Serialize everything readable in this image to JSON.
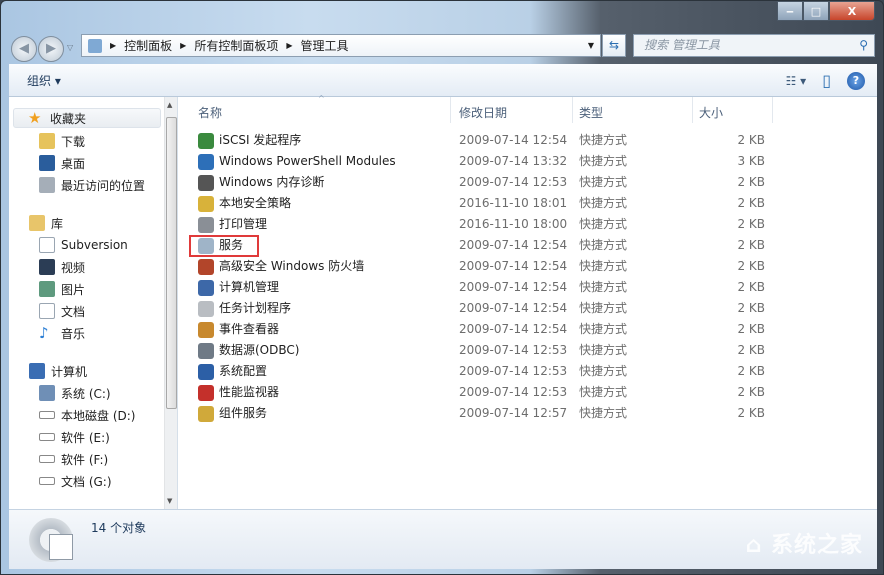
{
  "window": {
    "minimize": "‒",
    "maximize": "□",
    "close": "X"
  },
  "address": {
    "segments": [
      "控制面板",
      "所有控制面板项",
      "管理工具"
    ]
  },
  "search": {
    "placeholder": "搜索 管理工具"
  },
  "toolbar": {
    "organize": "组织 ▾",
    "views": "☷ ▾",
    "preview": "▯",
    "help": "?"
  },
  "nav": {
    "favorites": {
      "label": "收藏夹",
      "items": [
        "下载",
        "桌面",
        "最近访问的位置"
      ]
    },
    "libraries": {
      "label": "库",
      "items": [
        "Subversion",
        "视频",
        "图片",
        "文档",
        "音乐"
      ]
    },
    "computer": {
      "label": "计算机",
      "items": [
        "系统 (C:)",
        "本地磁盘 (D:)",
        "软件 (E:)",
        "软件 (F:)",
        "文档 (G:)"
      ]
    }
  },
  "columns": {
    "name": "名称",
    "date": "修改日期",
    "type": "类型",
    "size": "大小"
  },
  "files": [
    {
      "name": "iSCSI 发起程序",
      "date": "2009-07-14 12:54",
      "type": "快捷方式",
      "size": "2 KB",
      "color": "#3a8a3e"
    },
    {
      "name": "Windows PowerShell Modules",
      "date": "2009-07-14 13:32",
      "type": "快捷方式",
      "size": "3 KB",
      "color": "#2d6fb8"
    },
    {
      "name": "Windows 内存诊断",
      "date": "2009-07-14 12:53",
      "type": "快捷方式",
      "size": "2 KB",
      "color": "#555"
    },
    {
      "name": "本地安全策略",
      "date": "2016-11-10 18:01",
      "type": "快捷方式",
      "size": "2 KB",
      "color": "#d8b23a"
    },
    {
      "name": "打印管理",
      "date": "2016-11-10 18:00",
      "type": "快捷方式",
      "size": "2 KB",
      "color": "#8a8f96"
    },
    {
      "name": "服务",
      "date": "2009-07-14 12:54",
      "type": "快捷方式",
      "size": "2 KB",
      "color": "#9fb4c8"
    },
    {
      "name": "高级安全 Windows 防火墙",
      "date": "2009-07-14 12:54",
      "type": "快捷方式",
      "size": "2 KB",
      "color": "#b2452a"
    },
    {
      "name": "计算机管理",
      "date": "2009-07-14 12:54",
      "type": "快捷方式",
      "size": "2 KB",
      "color": "#3d68a8"
    },
    {
      "name": "任务计划程序",
      "date": "2009-07-14 12:54",
      "type": "快捷方式",
      "size": "2 KB",
      "color": "#b9bdc2"
    },
    {
      "name": "事件查看器",
      "date": "2009-07-14 12:54",
      "type": "快捷方式",
      "size": "2 KB",
      "color": "#c8892e"
    },
    {
      "name": "数据源(ODBC)",
      "date": "2009-07-14 12:53",
      "type": "快捷方式",
      "size": "2 KB",
      "color": "#6f7a86"
    },
    {
      "name": "系统配置",
      "date": "2009-07-14 12:53",
      "type": "快捷方式",
      "size": "2 KB",
      "color": "#2c5fa6"
    },
    {
      "name": "性能监视器",
      "date": "2009-07-14 12:53",
      "type": "快捷方式",
      "size": "2 KB",
      "color": "#c4302b"
    },
    {
      "name": "组件服务",
      "date": "2009-07-14 12:57",
      "type": "快捷方式",
      "size": "2 KB",
      "color": "#d0a93a"
    }
  ],
  "status": {
    "count": "14 个对象"
  },
  "watermark": "系统之家"
}
